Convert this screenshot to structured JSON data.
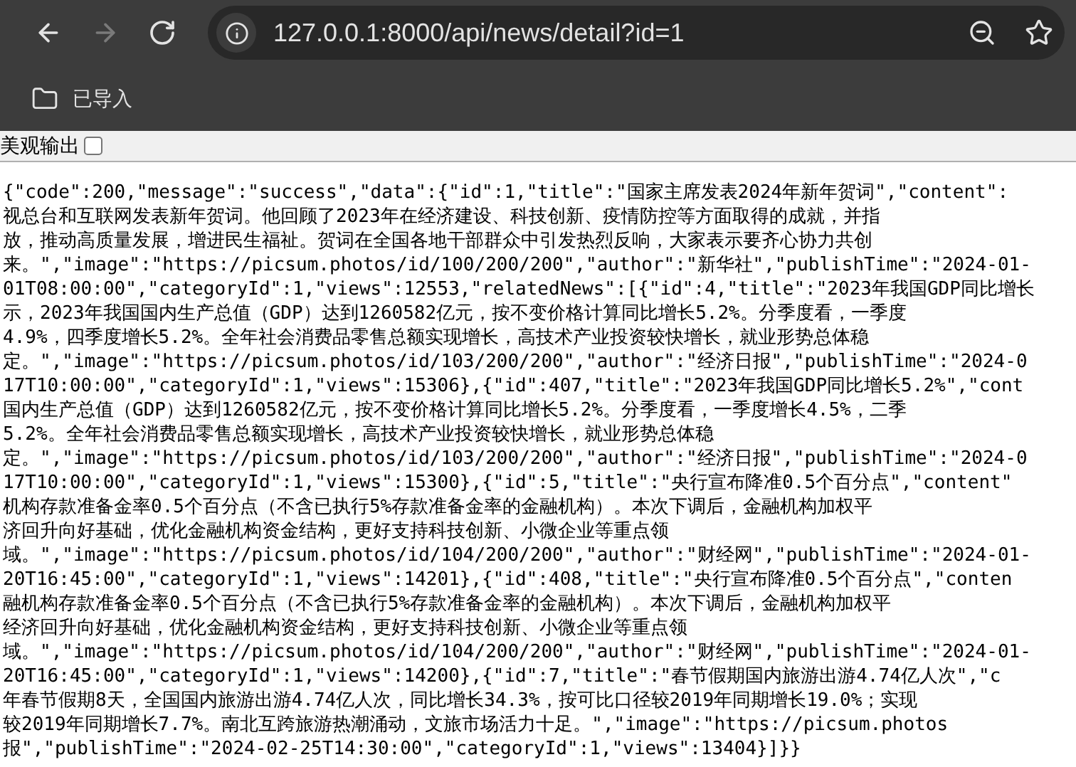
{
  "browser": {
    "nav_buttons": [
      {
        "kind": "back",
        "disabled": false
      },
      {
        "kind": "forward",
        "disabled": true
      },
      {
        "kind": "reload",
        "disabled": false
      }
    ],
    "url": "127.0.0.1:8000/api/news/detail?id=1",
    "bookmarks": [
      {
        "label": "已导入"
      }
    ]
  },
  "page": {
    "pretty_print": {
      "label": "美观输出",
      "checked": false
    },
    "output_lines": [
      "{\"code\":200,\"message\":\"success\",\"data\":{\"id\":1,\"title\":\"国家主席发表2024年新年贺词\",\"content\":",
      "视总台和互联网发表新年贺词。他回顾了2023年在经济建设、科技创新、疫情防控等方面取得的成就，并指",
      "放，推动高质量发展，增进民生福祉。贺词在全国各地干部群众中引发热烈反响，大家表示要齐心协力共创",
      "来。\",\"image\":\"https://picsum.photos/id/100/200/200\",\"author\":\"新华社\",\"publishTime\":\"2024-01-",
      "01T08:00:00\",\"categoryId\":1,\"views\":12553,\"relatedNews\":[{\"id\":4,\"title\":\"2023年我国GDP同比增长",
      "示，2023年我国国内生产总值（GDP）达到1260582亿元，按不变价格计算同比增长5.2%。分季度看，一季度",
      "4.9%，四季度增长5.2%。全年社会消费品零售总额实现增长，高技术产业投资较快增长，就业形势总体稳",
      "定。\",\"image\":\"https://picsum.photos/id/103/200/200\",\"author\":\"经济日报\",\"publishTime\":\"2024-0",
      "17T10:00:00\",\"categoryId\":1,\"views\":15306},{\"id\":407,\"title\":\"2023年我国GDP同比增长5.2%\",\"cont",
      "国内生产总值（GDP）达到1260582亿元，按不变价格计算同比增长5.2%。分季度看，一季度增长4.5%，二季",
      "5.2%。全年社会消费品零售总额实现增长，高技术产业投资较快增长，就业形势总体稳",
      "定。\",\"image\":\"https://picsum.photos/id/103/200/200\",\"author\":\"经济日报\",\"publishTime\":\"2024-0",
      "17T10:00:00\",\"categoryId\":1,\"views\":15300},{\"id\":5,\"title\":\"央行宣布降准0.5个百分点\",\"content\"",
      "机构存款准备金率0.5个百分点（不含已执行5%存款准备金率的金融机构）。本次下调后，金融机构加权平",
      "济回升向好基础，优化金融机构资金结构，更好支持科技创新、小微企业等重点领",
      "域。\",\"image\":\"https://picsum.photos/id/104/200/200\",\"author\":\"财经网\",\"publishTime\":\"2024-01-",
      "20T16:45:00\",\"categoryId\":1,\"views\":14201},{\"id\":408,\"title\":\"央行宣布降准0.5个百分点\",\"conten",
      "融机构存款准备金率0.5个百分点（不含已执行5%存款准备金率的金融机构）。本次下调后，金融机构加权平",
      "经济回升向好基础，优化金融机构资金结构，更好支持科技创新、小微企业等重点领",
      "域。\",\"image\":\"https://picsum.photos/id/104/200/200\",\"author\":\"财经网\",\"publishTime\":\"2024-01-",
      "20T16:45:00\",\"categoryId\":1,\"views\":14200},{\"id\":7,\"title\":\"春节假期国内旅游出游4.74亿人次\",\"c",
      "年春节假期8天，全国国内旅游出游4.74亿人次，同比增长34.3%，按可比口径较2019年同期增长19.0%；实现",
      "较2019年同期增长7.7%。南北互跨旅游热潮涌动，文旅市场活力十足。\",\"image\":\"https://picsum.photos",
      "报\",\"publishTime\":\"2024-02-25T14:30:00\",\"categoryId\":1,\"views\":13404}]}}"
    ]
  }
}
